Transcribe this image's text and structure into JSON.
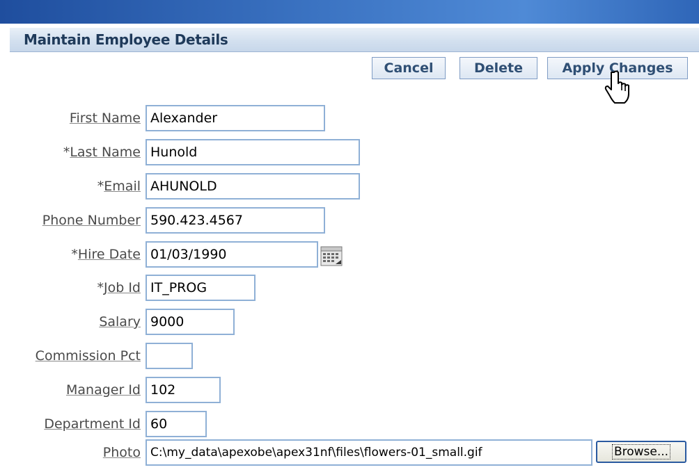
{
  "region": {
    "title": "Maintain Employee Details"
  },
  "buttons": {
    "cancel": "Cancel",
    "delete": "Delete",
    "apply": "Apply Changes"
  },
  "form": {
    "first_name": {
      "label": "First Name",
      "required": "",
      "value": "Alexander"
    },
    "last_name": {
      "label": "Last Name",
      "required": "*",
      "value": "Hunold"
    },
    "email": {
      "label": "Email",
      "required": "*",
      "value": "AHUNOLD"
    },
    "phone": {
      "label": "Phone Number",
      "required": "",
      "value": "590.423.4567"
    },
    "hire_date": {
      "label": "Hire Date",
      "required": "*",
      "value": "01/03/1990"
    },
    "job_id": {
      "label": "Job Id",
      "required": "*",
      "value": "IT_PROG"
    },
    "salary": {
      "label": "Salary",
      "required": "",
      "value": "9000"
    },
    "commission": {
      "label": "Commission Pct",
      "required": "",
      "value": ""
    },
    "manager_id": {
      "label": "Manager Id",
      "required": "",
      "value": "102"
    },
    "department_id": {
      "label": "Department Id",
      "required": "",
      "value": "60"
    },
    "photo": {
      "label": "Photo",
      "required": "",
      "value": "C:\\my_data\\apexobe\\apex31nf\\files\\flowers-01_small.gif",
      "browse": "Browse..."
    }
  },
  "icons": {
    "calendar": "calendar-icon",
    "cursor": "hand-pointer-icon"
  },
  "colors": {
    "accent": "#2f66b8",
    "field_border": "#8fb0d6",
    "button_text": "#2f4f74"
  }
}
